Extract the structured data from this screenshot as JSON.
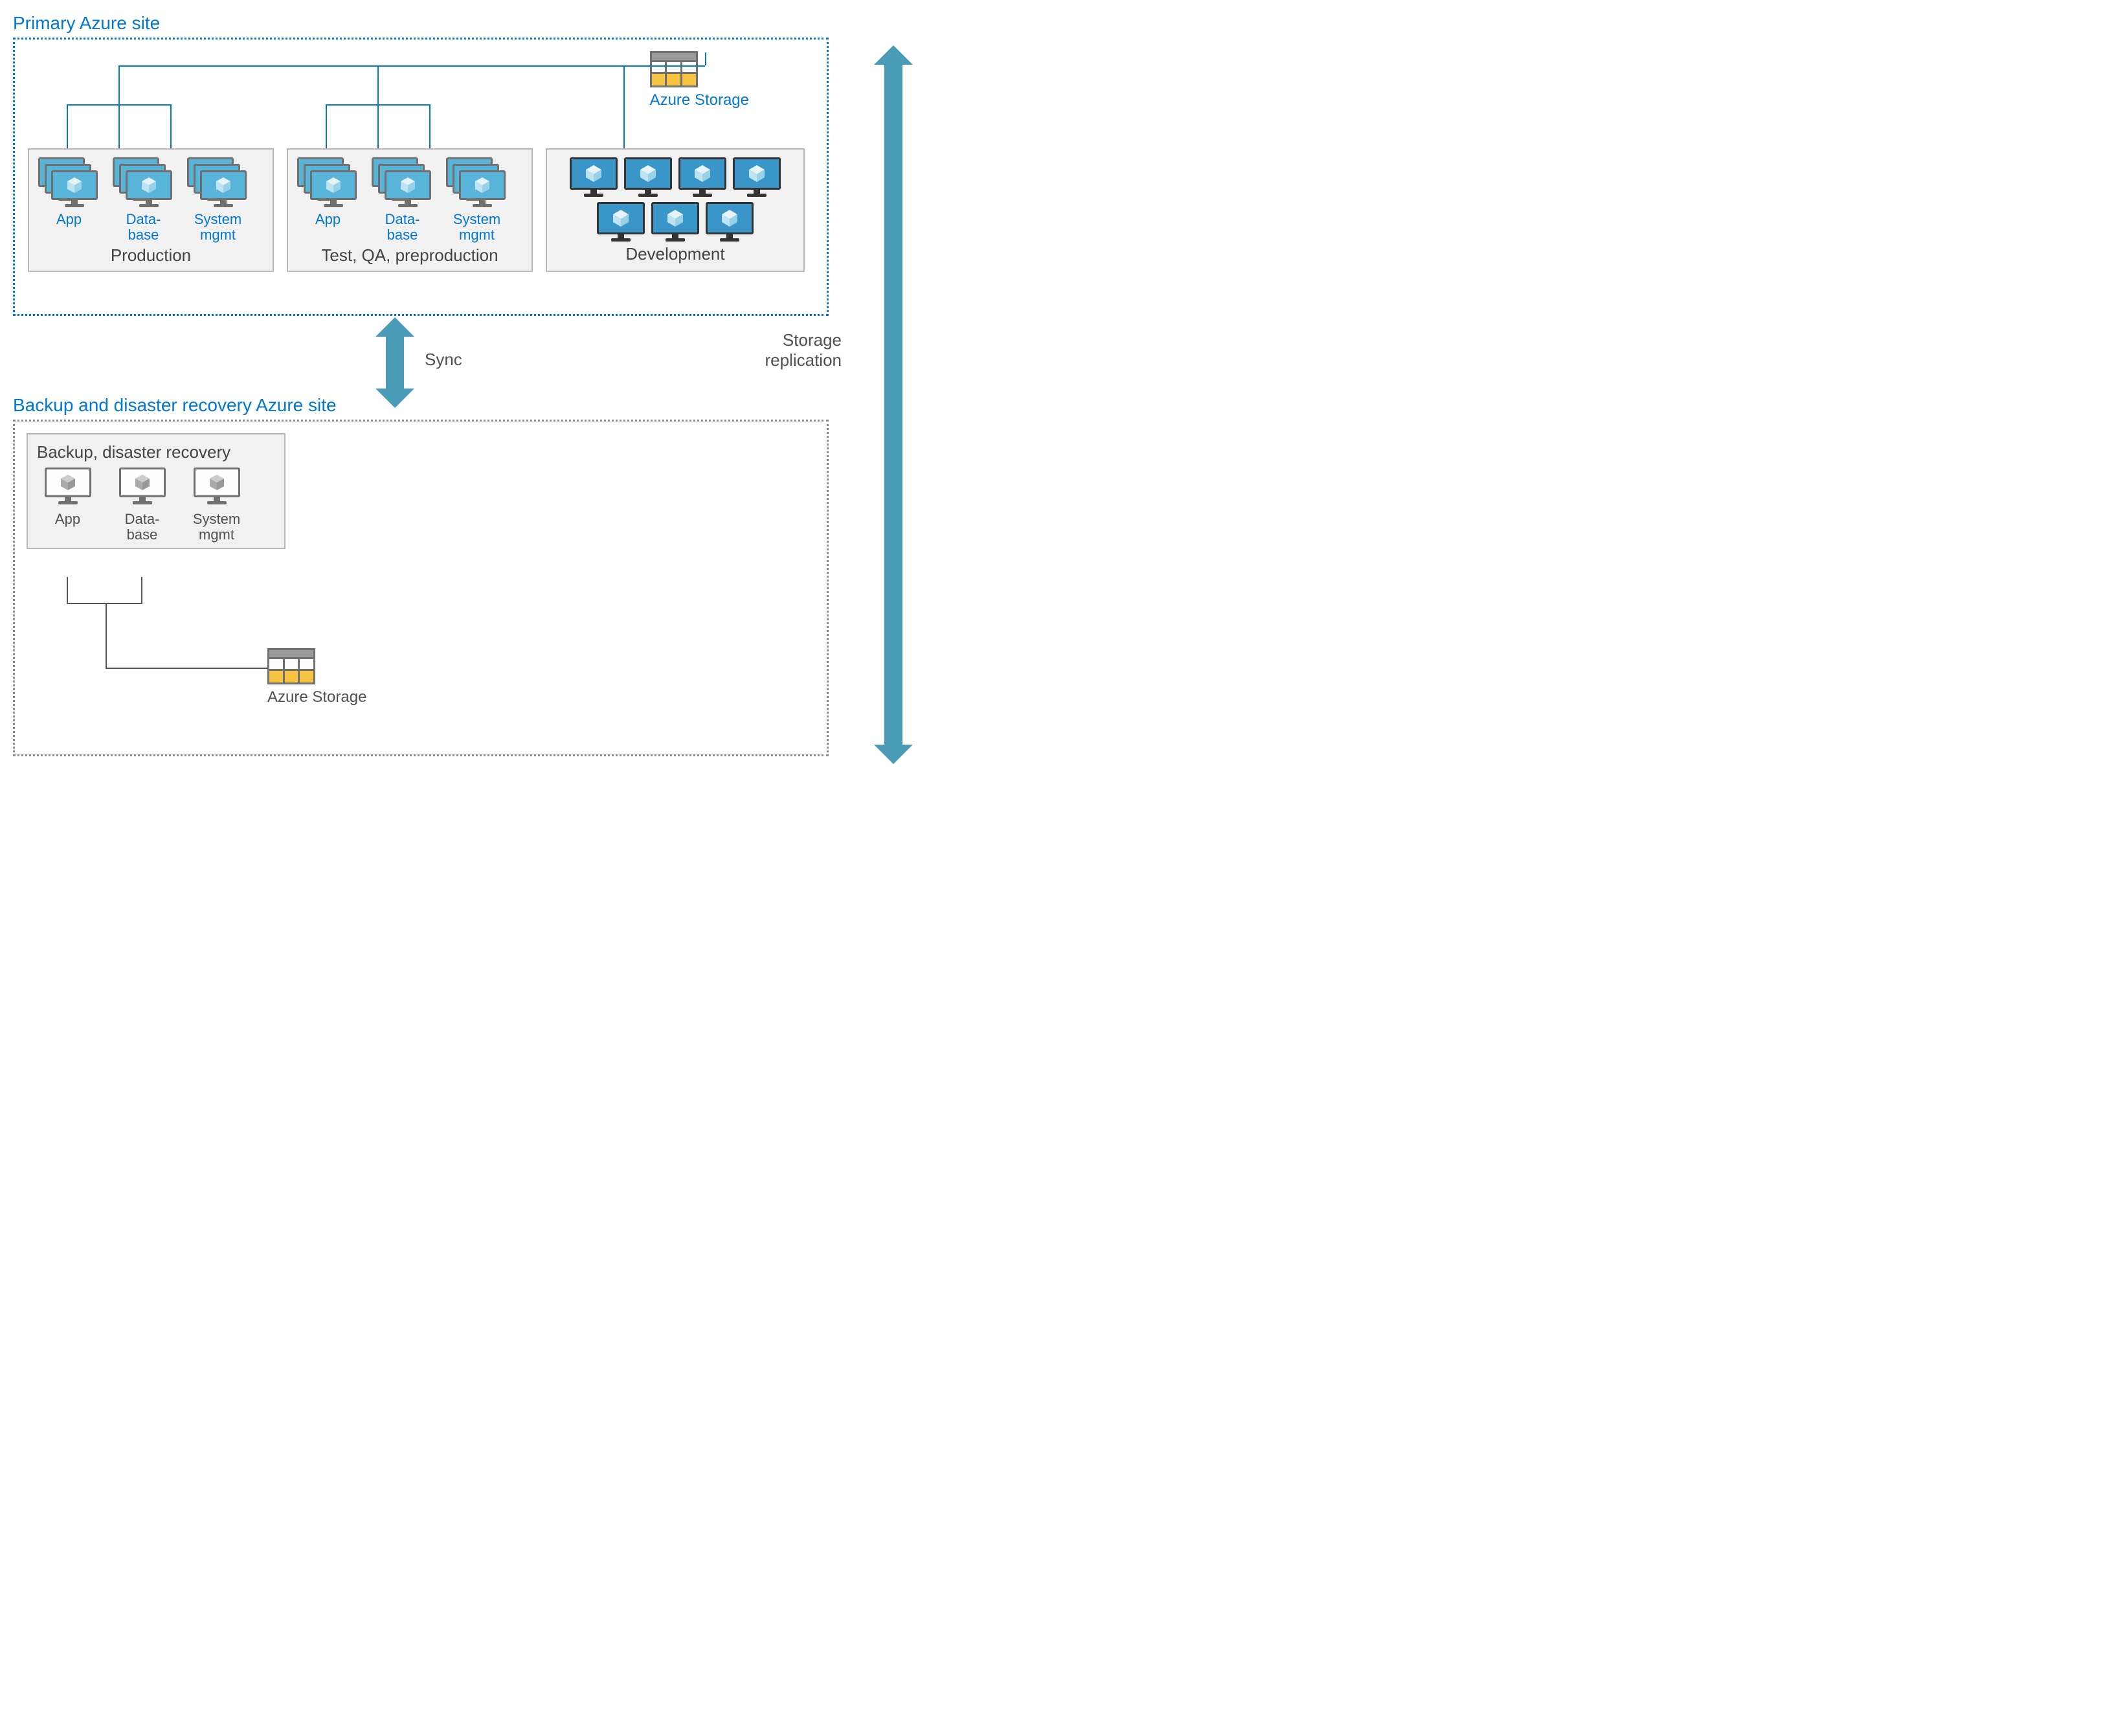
{
  "colors": {
    "azure_blue": "#0078d4",
    "teal": "#4a9bb5",
    "gray": "#707070",
    "yellow": "#f6c343"
  },
  "primary": {
    "title": "Primary Azure site",
    "storage": {
      "label": "Azure Storage"
    },
    "groups": {
      "production": {
        "title": "Production",
        "labels": {
          "app": "App",
          "db": "Data-\nbase",
          "sys": "System\nmgmt"
        }
      },
      "test": {
        "title": "Test, QA, preproduction",
        "labels": {
          "app": "App",
          "db": "Data-\nbase",
          "sys": "System\nmgmt"
        }
      },
      "dev": {
        "title": "Development"
      }
    }
  },
  "sync_label": "Sync",
  "storage_replication_label": "Storage\nreplication",
  "backup": {
    "title": "Backup and disaster recovery Azure site",
    "group_title": "Backup, disaster recovery",
    "labels": {
      "app": "App",
      "db": "Data-\nbase",
      "sys": "System\nmgmt"
    },
    "storage": {
      "label": "Azure Storage"
    }
  }
}
